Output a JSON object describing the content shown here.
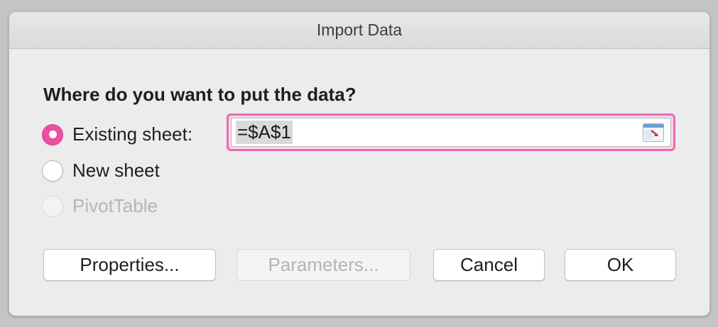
{
  "dialog": {
    "title": "Import Data",
    "question": "Where do you want to put the data?"
  },
  "options": {
    "existing_sheet": {
      "label": "Existing sheet:",
      "selected": true
    },
    "new_sheet": {
      "label": "New sheet",
      "selected": false
    },
    "pivot_table": {
      "label": "PivotTable",
      "selected": false,
      "enabled": false
    }
  },
  "reference": {
    "value": "=$A$1",
    "collapse_icon": "collapse-dialog-icon"
  },
  "buttons": {
    "properties": "Properties...",
    "parameters": "Parameters...",
    "cancel": "Cancel",
    "ok": "OK"
  },
  "colors": {
    "accent": "#e94fa2",
    "focus_ring": "#e96bb0"
  }
}
